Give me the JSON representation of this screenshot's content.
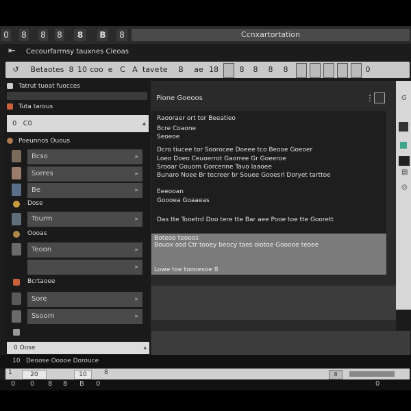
{
  "window": {
    "title": "Ccnxartortation",
    "title_buttons": [
      "0",
      "8",
      "8",
      "8",
      "8",
      "B",
      "8"
    ]
  },
  "menu": {
    "breadcrumb": "Cecourfarrnsy tauxnes Cieoas"
  },
  "toolbar": {
    "items": [
      "Betaotes",
      "8",
      "10",
      "coo",
      "e",
      "C",
      "A",
      "tave",
      "te",
      "B",
      "ae",
      "18"
    ],
    "icons_right": [
      "8",
      "8",
      "8",
      "8",
      "0"
    ]
  },
  "sidebar": {
    "header_label": "Tatrut tuoat fuocces",
    "row2_label": "Tuta tarous",
    "select_value": "0",
    "select_code": "C0",
    "section1_label": "Poeunnos Ouous",
    "items": [
      {
        "label": "Bcso"
      },
      {
        "label": "Sorres"
      },
      {
        "label": "Be"
      },
      {
        "label": "Tourm"
      },
      {
        "label": "Teoon"
      },
      {
        "label": "Sore"
      },
      {
        "label": "Ssoom"
      }
    ],
    "section2_label": "Dose",
    "section3_label": "Oooas",
    "section4_label": "Bcrtaoee",
    "footer_input": "0 Oose",
    "footer_label": "Dooane Torcebos Doorures"
  },
  "main": {
    "panel_title": "Pione Goeoos",
    "menu_icon": "⋮",
    "doc_lines": [
      "Raooraer ort tor Beeatieo",
      "Bcre Coaone",
      "Seoeoe",
      "Dcro tiucee tor Soorocee Doeee tco Beooe Goeoer",
      "Loeo Doeo Ceuoerrot Gaorree Gr Goeeroe",
      "Srooar Gouorn Gorcenne Tavo Iaaoee",
      "Bunaro Noee Br tecreer br Souee Gooesrl Doryet tarttoe",
      "Eeeooan",
      "Goooea Goaaeas",
      "Das tte Tooetrd Doo tere tte Bar aee Pooe toe tte Goorett"
    ],
    "selected_lines": [
      "Boteoe teooos",
      "Bouox osd Ctr tooey beocy taes oiotoe Gooooe teoee",
      "Lowe toe toooesoe 8"
    ]
  },
  "status": {
    "text": "Deoose Ooooe Dorouce",
    "count": "10"
  },
  "bottombar": {
    "left": "1",
    "field1": "20",
    "field2": "10",
    "field3": "8",
    "right_icon": "8"
  },
  "tray": {
    "items": [
      "0",
      "0",
      "8",
      "8",
      "B",
      "0",
      "0"
    ]
  },
  "colors": {
    "frame_bg": "#1c1c1c",
    "toolbar_bg": "#c9c9c9",
    "selection": "#7b7b7b",
    "accent_green": "#3fa58a",
    "accent_orange": "#c8603a"
  }
}
